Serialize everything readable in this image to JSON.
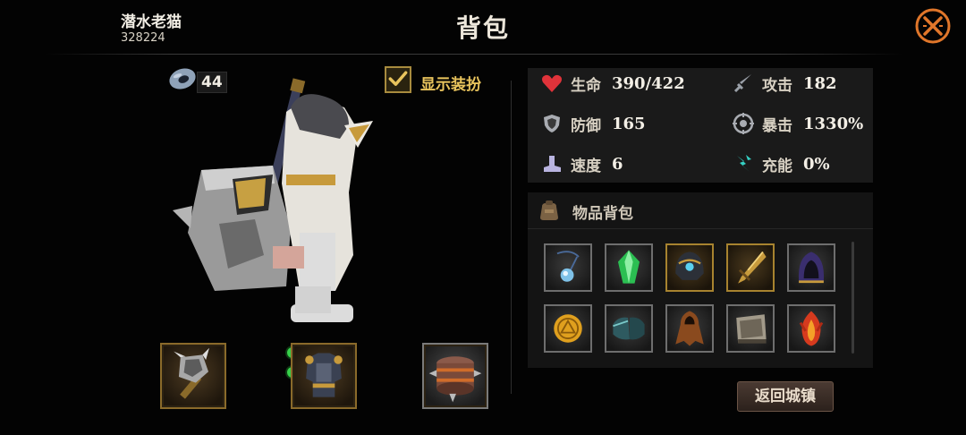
{
  "header": {
    "player_name": "潜水老猫",
    "player_id": "328224",
    "title": "背包"
  },
  "currency": {
    "icon": "ring-currency-icon",
    "count": "44"
  },
  "outfit_toggle": {
    "label": "显示装扮",
    "checked": true
  },
  "stats": [
    {
      "icon": "heart-icon",
      "label": "生命",
      "value": "390/422"
    },
    {
      "icon": "sword-icon",
      "label": "攻击",
      "value": "182"
    },
    {
      "icon": "shield-icon",
      "label": "防御",
      "value": "165"
    },
    {
      "icon": "crit-icon",
      "label": "暴击",
      "value": "1330%"
    },
    {
      "icon": "boot-icon",
      "label": "速度",
      "value": "6"
    },
    {
      "icon": "charge-icon",
      "label": "充能",
      "value": "0%"
    }
  ],
  "inventory": {
    "title": "物品背包",
    "items": [
      {
        "name": "pendant"
      },
      {
        "name": "green-crystal"
      },
      {
        "name": "dark-helmet"
      },
      {
        "name": "golden-blade"
      },
      {
        "name": "purple-hood"
      },
      {
        "name": "gold-coin"
      },
      {
        "name": "teal-shoulder-armor"
      },
      {
        "name": "brown-robe"
      },
      {
        "name": "scroll-book"
      },
      {
        "name": "fire-claw"
      }
    ]
  },
  "equipment": [
    {
      "name": "spiked-mace"
    },
    {
      "name": "plate-armor"
    },
    {
      "name": "spiked-drum"
    }
  ],
  "buttons": {
    "return_label": "返回城镇"
  },
  "colors": {
    "gold_border": "#a7832f",
    "accent_yellow": "#e9c45d",
    "gem_green": "#37d04a"
  }
}
